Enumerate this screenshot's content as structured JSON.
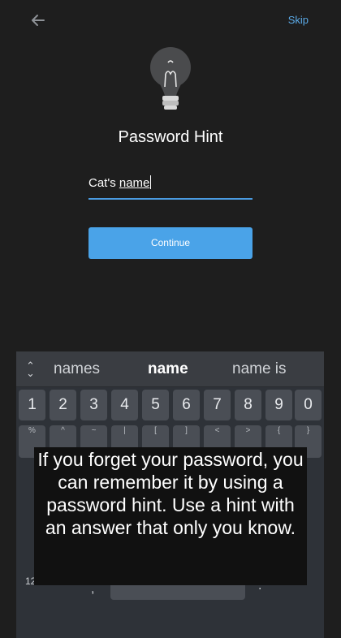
{
  "header": {
    "skip_label": "Skip"
  },
  "main": {
    "title": "Password Hint",
    "hint_prefix": "Cat's ",
    "hint_underlined": "name",
    "continue_label": "Continue"
  },
  "keyboard": {
    "suggestions": [
      "names",
      "name",
      "name is"
    ],
    "numbers": [
      "1",
      "2",
      "3",
      "4",
      "5",
      "6",
      "7",
      "8",
      "9",
      "0"
    ],
    "symbols": [
      "%",
      "^",
      "~",
      "|",
      "[",
      "]",
      "<",
      ">",
      "{",
      "}"
    ],
    "mode_label": "12",
    "comma": ",",
    "period": "."
  },
  "tooltip": {
    "text": "If you forget your password, you can remember it by using a password hint. Use a hint with an answer that only you know."
  },
  "colors": {
    "accent": "#4aa3e8",
    "link": "#5aa9e6",
    "background": "#1e1e1e"
  }
}
